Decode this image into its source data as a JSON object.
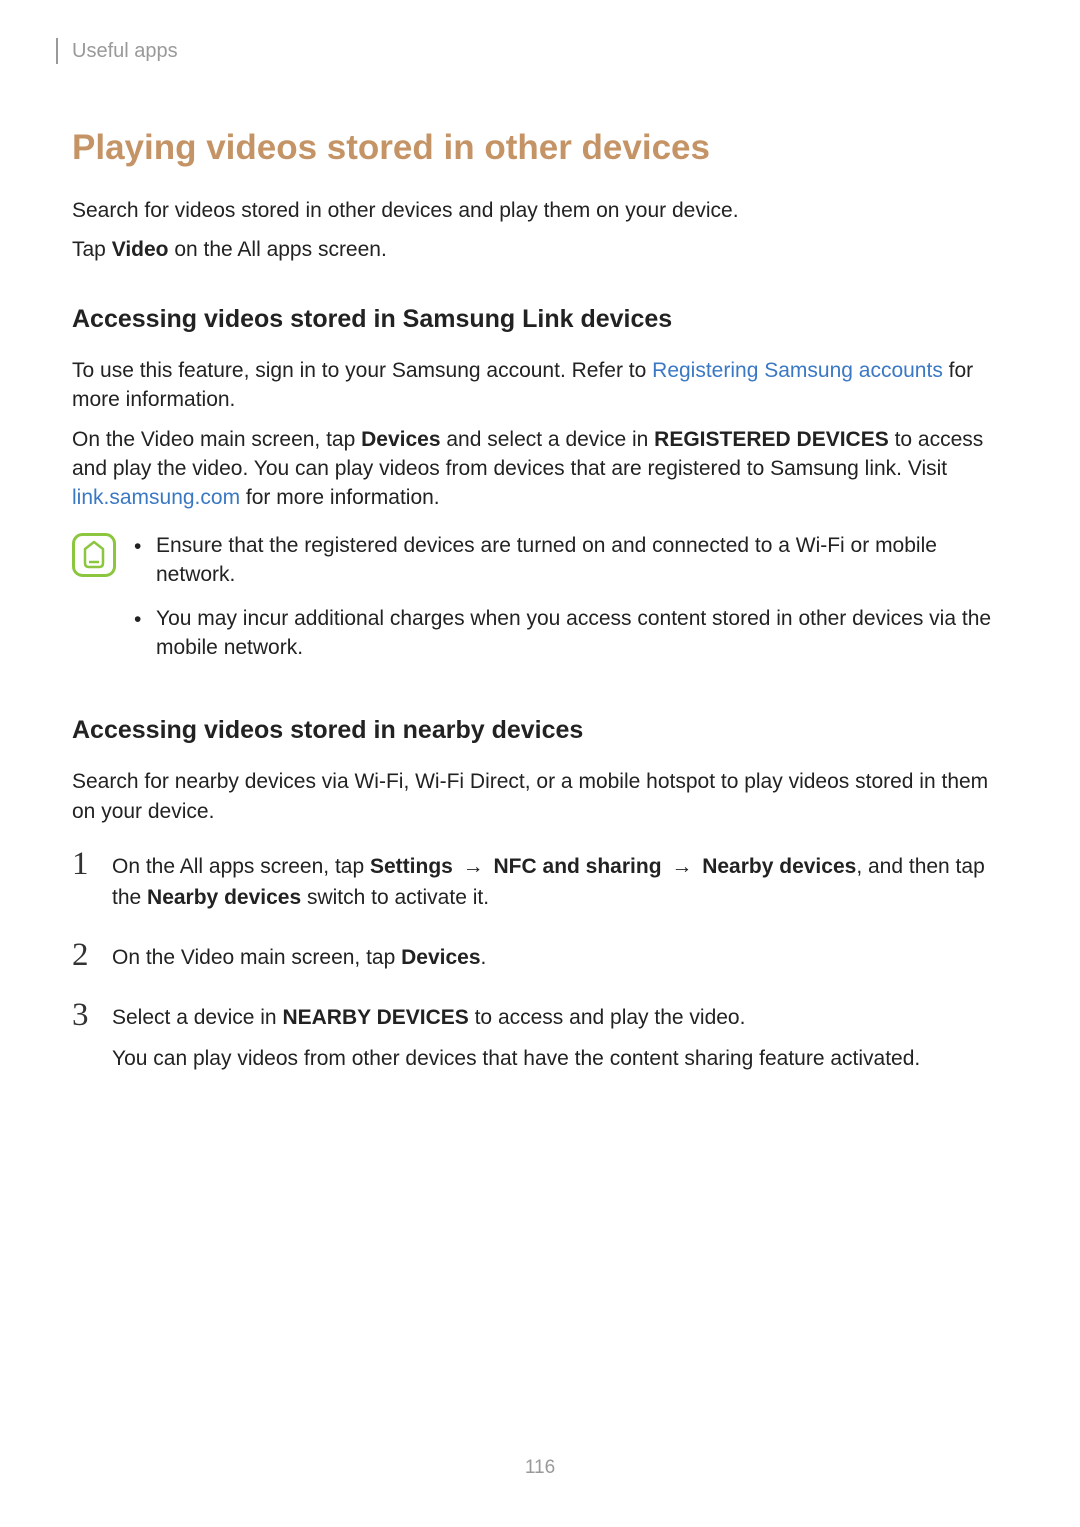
{
  "header": {
    "section": "Useful apps"
  },
  "title": "Playing videos stored in other devices",
  "intro1": "Search for videos stored in other devices and play them on your device.",
  "intro2_a": "Tap ",
  "intro2_b": "Video",
  "intro2_c": " on the All apps screen.",
  "sub1": {
    "heading": "Accessing videos stored in Samsung Link devices",
    "p1_a": "To use this feature, sign in to your Samsung account. Refer to ",
    "p1_link": "Registering Samsung accounts",
    "p1_b": " for more information.",
    "p2_a": "On the Video main screen, tap ",
    "p2_b": "Devices",
    "p2_c": " and select a device in ",
    "p2_d": "REGISTERED DEVICES",
    "p2_e": " to access and play the video. You can play videos from devices that are registered to Samsung link. Visit ",
    "p2_link": "link.samsung.com",
    "p2_f": " for more information.",
    "notes": [
      "Ensure that the registered devices are turned on and connected to a Wi-Fi or mobile network.",
      "You may incur additional charges when you access content stored in other devices via the mobile network."
    ]
  },
  "sub2": {
    "heading": "Accessing videos stored in nearby devices",
    "intro": "Search for nearby devices via Wi-Fi, Wi-Fi Direct, or a mobile hotspot to play videos stored in them on your device.",
    "steps": {
      "s1_a": "On the All apps screen, tap ",
      "s1_b": "Settings",
      "s1_arrow1": " → ",
      "s1_c": "NFC and sharing",
      "s1_arrow2": " → ",
      "s1_d": "Nearby devices",
      "s1_e": ", and then tap the ",
      "s1_f": "Nearby devices",
      "s1_g": " switch to activate it.",
      "s2_a": "On the Video main screen, tap ",
      "s2_b": "Devices",
      "s2_c": ".",
      "s3_a": "Select a device in ",
      "s3_b": "NEARBY DEVICES",
      "s3_c": " to access and play the video.",
      "s3_p2": "You can play videos from other devices that have the content sharing feature activated."
    },
    "numbers": [
      "1",
      "2",
      "3"
    ]
  },
  "pageNumber": "116"
}
